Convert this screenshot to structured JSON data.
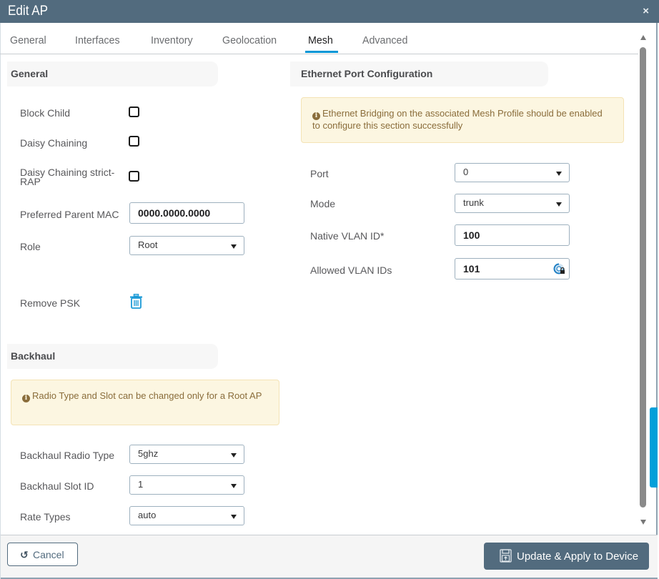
{
  "window": {
    "title": "Edit AP",
    "close_icon": "×"
  },
  "tabs": [
    {
      "label": "General",
      "active": false
    },
    {
      "label": "Interfaces",
      "active": false
    },
    {
      "label": "Inventory",
      "active": false
    },
    {
      "label": "Geolocation",
      "active": false
    },
    {
      "label": "Mesh",
      "active": true
    },
    {
      "label": "Advanced",
      "active": false
    }
  ],
  "general": {
    "heading": "General",
    "block_child": {
      "label": "Block Child",
      "checked": false
    },
    "daisy_chaining": {
      "label": "Daisy Chaining",
      "checked": false
    },
    "daisy_chaining_strict_rap": {
      "label_line1": "Daisy Chaining strict-",
      "label_line2": "RAP",
      "checked": false
    },
    "preferred_parent_mac": {
      "label": "Preferred Parent MAC",
      "value": "0000.0000.0000"
    },
    "role": {
      "label": "Role",
      "value": "Root"
    },
    "remove_psk": {
      "label": "Remove PSK",
      "icon": "trash-icon"
    }
  },
  "backhaul": {
    "heading": "Backhaul",
    "alert": "Radio Type and Slot can be changed only for a Root AP",
    "radio_type": {
      "label": "Backhaul Radio Type",
      "value": "5ghz"
    },
    "slot_id": {
      "label": "Backhaul Slot ID",
      "value": "1"
    },
    "rate_types": {
      "label": "Rate Types",
      "value": "auto"
    }
  },
  "ethernet": {
    "heading": "Ethernet Port Configuration",
    "alert": "Ethernet Bridging on the associated Mesh Profile should be enabled to configure this section successfully",
    "port": {
      "label": "Port",
      "value": "0"
    },
    "mode": {
      "label": "Mode",
      "value": "trunk"
    },
    "native_vlan": {
      "label": "Native VLAN ID*",
      "value": "100"
    },
    "allowed_vlans": {
      "label": "Allowed VLAN IDs",
      "value": "101"
    }
  },
  "footer": {
    "cancel_label": "Cancel",
    "apply_label": "Update & Apply to Device"
  },
  "colors": {
    "header": "#526b7e",
    "accent": "#0096d6",
    "alert_bg": "#fcf6e1",
    "alert_text": "#8a6d3b"
  }
}
